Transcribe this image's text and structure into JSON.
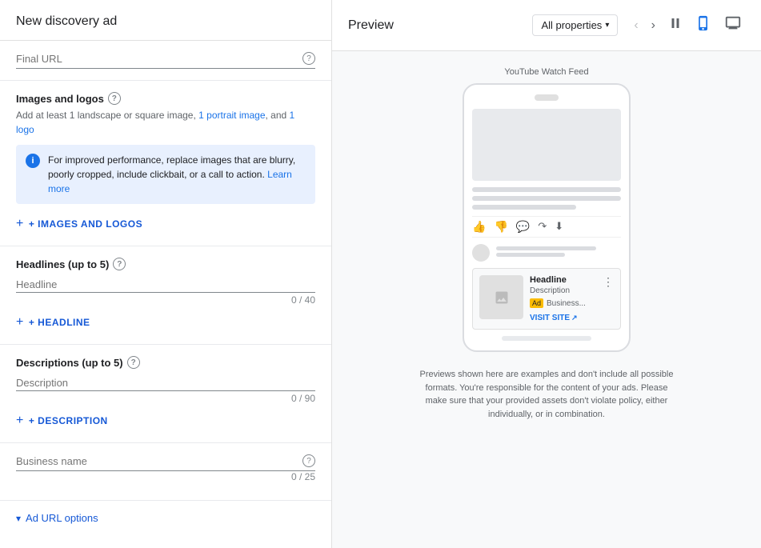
{
  "leftPanel": {
    "title": "New discovery ad",
    "finalUrl": {
      "label": "Final URL",
      "placeholder": "Final URL",
      "value": ""
    },
    "imagesAndLogos": {
      "heading": "Images and logos",
      "subtext_prefix": "Add at least 1 landscape or square image, ",
      "subtext_link1": "1 portrait image",
      "subtext_mid": ", and ",
      "subtext_link2": "1 logo",
      "infoBox": {
        "text": "For improved performance, replace images that are blurry, poorly cropped, include clickbait, or a call to action.",
        "linkText": "Learn more"
      },
      "addButton": "+ IMAGES AND LOGOS"
    },
    "headlines": {
      "heading": "Headlines (up to 5)",
      "label": "Headline",
      "placeholder": "Headline",
      "charCount": "0 / 40",
      "addButton": "+ HEADLINE"
    },
    "descriptions": {
      "heading": "Descriptions (up to 5)",
      "label": "Description",
      "placeholder": "Description",
      "charCount": "0 / 90",
      "addButton": "+ DESCRIPTION"
    },
    "businessName": {
      "label": "Business name",
      "placeholder": "Business name",
      "charCount": "0 / 25"
    },
    "adUrlOptions": {
      "label": "Ad URL options"
    }
  },
  "rightPanel": {
    "title": "Preview",
    "dropdown": "All properties",
    "preview": {
      "feedLabel": "YouTube Watch Feed",
      "adCard": {
        "title": "Headline",
        "description": "Description",
        "badge": "Ad",
        "businessLabel": "Business...",
        "visitSite": "VISIT SITE"
      }
    },
    "footer": "Previews shown here are examples and don't include all possible formats. You're responsible for the content of your ads. Please make sure that your provided assets don't violate policy, either individually, or in combination."
  }
}
